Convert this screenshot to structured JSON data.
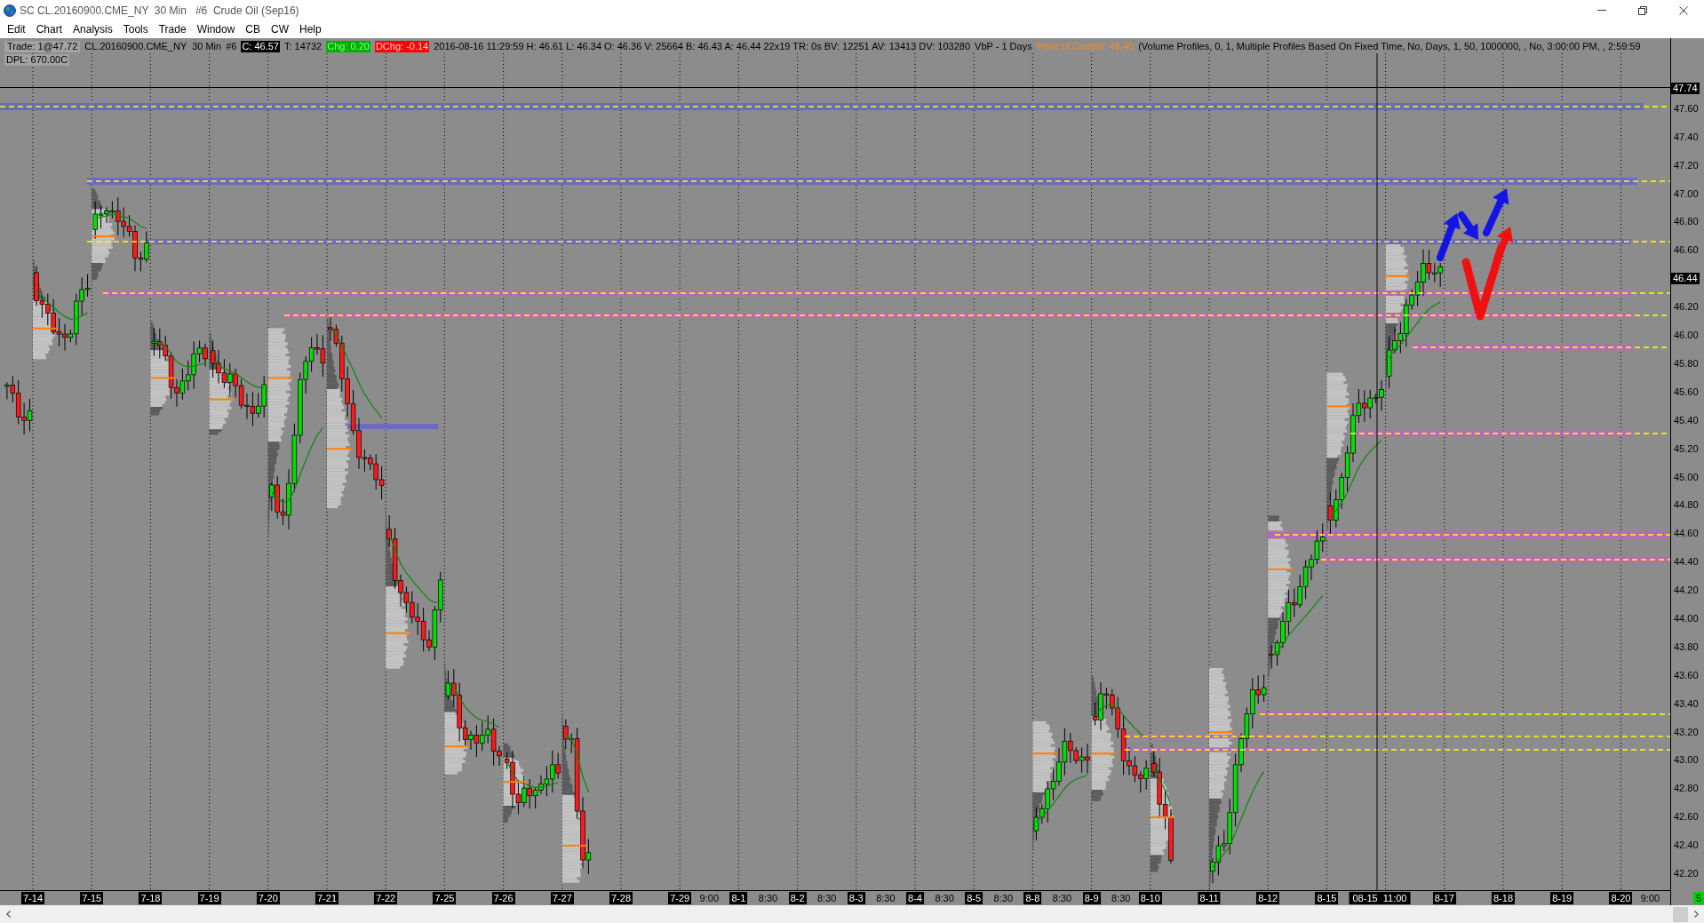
{
  "window": {
    "title": "SC CL.20160900.CME_NY  30 Min   #6  Crude Oil (Sep16)"
  },
  "menu": [
    {
      "label": "Edit"
    },
    {
      "label": "Chart"
    },
    {
      "label": "Analysis"
    },
    {
      "label": "Tools"
    },
    {
      "label": "Trade"
    },
    {
      "label": "Window"
    },
    {
      "label": "CB"
    },
    {
      "label": "CW"
    },
    {
      "label": "Help"
    }
  ],
  "chart_header": {
    "info_line": [
      {
        "text": "Trade: 1@47.72",
        "kind": "boxed"
      },
      {
        "text": "CL.20160900.CME_NY  30 Min",
        "kind": "plain"
      },
      {
        "text": "#6",
        "kind": "plain"
      },
      {
        "text": "C: 46.57",
        "kind": "close"
      },
      {
        "text": "T: 14732",
        "kind": "plain"
      },
      {
        "text": "Chg: 0.20",
        "kind": "up"
      },
      {
        "text": "DChg: -0.14",
        "kind": "down"
      },
      {
        "text": "2016-08-16 11:29:59 H: 46.61 L: 46.34 O: 46.36 V: 25664 B: 46.43 A: 46.44 22x19 TR: 0s BV: 12251 AV: 13413 DV: 103280",
        "kind": "plain"
      },
      {
        "text": "VbP - 1 Days",
        "kind": "plain"
      },
      {
        "text": "Point of Control: 46.40",
        "kind": "highlight"
      },
      {
        "text": "(Volume Profiles, 0, 1, Multiple Profiles Based On Fixed Time, No, Days, 1, 50, 1000000, , No, 3:00:00 PM, , 2:59:59",
        "kind": "plain"
      }
    ],
    "dpl": "DPL: 670.00C"
  },
  "price_axis": [
    {
      "text": "47.74",
      "kind": "marker"
    },
    {
      "text": "47.60",
      "kind": "label"
    },
    {
      "text": "47.40",
      "kind": "label"
    },
    {
      "text": "47.20",
      "kind": "label"
    },
    {
      "text": "47.00",
      "kind": "label"
    },
    {
      "text": "46.80",
      "kind": "label"
    },
    {
      "text": "46.60",
      "kind": "label"
    },
    {
      "text": "46.44",
      "kind": "marker"
    },
    {
      "text": "46.20",
      "kind": "label"
    },
    {
      "text": "46.00",
      "kind": "label"
    },
    {
      "text": "45.80",
      "kind": "label"
    },
    {
      "text": "45.60",
      "kind": "label"
    },
    {
      "text": "45.40",
      "kind": "label"
    },
    {
      "text": "45.20",
      "kind": "label"
    },
    {
      "text": "45.00",
      "kind": "label"
    },
    {
      "text": "44.80",
      "kind": "label"
    },
    {
      "text": "44.60",
      "kind": "label"
    },
    {
      "text": "44.40",
      "kind": "label"
    },
    {
      "text": "44.20",
      "kind": "label"
    },
    {
      "text": "44.00",
      "kind": "label"
    },
    {
      "text": "43.80",
      "kind": "label"
    },
    {
      "text": "43.60",
      "kind": "label"
    },
    {
      "text": "43.40",
      "kind": "label"
    },
    {
      "text": "43.20",
      "kind": "label"
    },
    {
      "text": "43.00",
      "kind": "label"
    },
    {
      "text": "42.80",
      "kind": "label"
    },
    {
      "text": "42.60",
      "kind": "label"
    },
    {
      "text": "42.40",
      "kind": "label"
    },
    {
      "text": "42.20",
      "kind": "label"
    }
  ],
  "time_axis": [
    {
      "text": "7-14",
      "kind": "date"
    },
    {
      "text": "7-15",
      "kind": "date"
    },
    {
      "text": "7-18",
      "kind": "date"
    },
    {
      "text": "7-19",
      "kind": "date"
    },
    {
      "text": "7-20",
      "kind": "date"
    },
    {
      "text": "7-21",
      "kind": "date"
    },
    {
      "text": "7-22",
      "kind": "date"
    },
    {
      "text": "7-25",
      "kind": "date"
    },
    {
      "text": "7-26",
      "kind": "date"
    },
    {
      "text": "7-27",
      "kind": "date"
    },
    {
      "text": "7-28",
      "kind": "date"
    },
    {
      "text": "7-29",
      "kind": "date"
    },
    {
      "text": "9:00",
      "kind": "time"
    },
    {
      "text": "8-1",
      "kind": "date"
    },
    {
      "text": "8:30",
      "kind": "time"
    },
    {
      "text": "8-2",
      "kind": "date"
    },
    {
      "text": "8:30",
      "kind": "time"
    },
    {
      "text": "8-3",
      "kind": "date"
    },
    {
      "text": "8:30",
      "kind": "time"
    },
    {
      "text": "8-4",
      "kind": "date"
    },
    {
      "text": "8:30",
      "kind": "time"
    },
    {
      "text": "8-5",
      "kind": "date"
    },
    {
      "text": "8:30",
      "kind": "time"
    },
    {
      "text": "8-8",
      "kind": "date"
    },
    {
      "text": "8:30",
      "kind": "time"
    },
    {
      "text": "8-9",
      "kind": "date"
    },
    {
      "text": "8:30",
      "kind": "time"
    },
    {
      "text": "8-10",
      "kind": "date"
    },
    {
      "text": "8-11",
      "kind": "date"
    },
    {
      "text": "8-12",
      "kind": "date"
    },
    {
      "text": "8-15",
      "kind": "date"
    },
    {
      "text": "08-15  11:00",
      "kind": "cursor"
    },
    {
      "text": "8-17",
      "kind": "date"
    },
    {
      "text": "8-18",
      "kind": "date"
    },
    {
      "text": "8-19",
      "kind": "date"
    },
    {
      "text": "8-20",
      "kind": "date"
    },
    {
      "text": "9:00",
      "kind": "time"
    }
  ],
  "status_badge": "5"
}
